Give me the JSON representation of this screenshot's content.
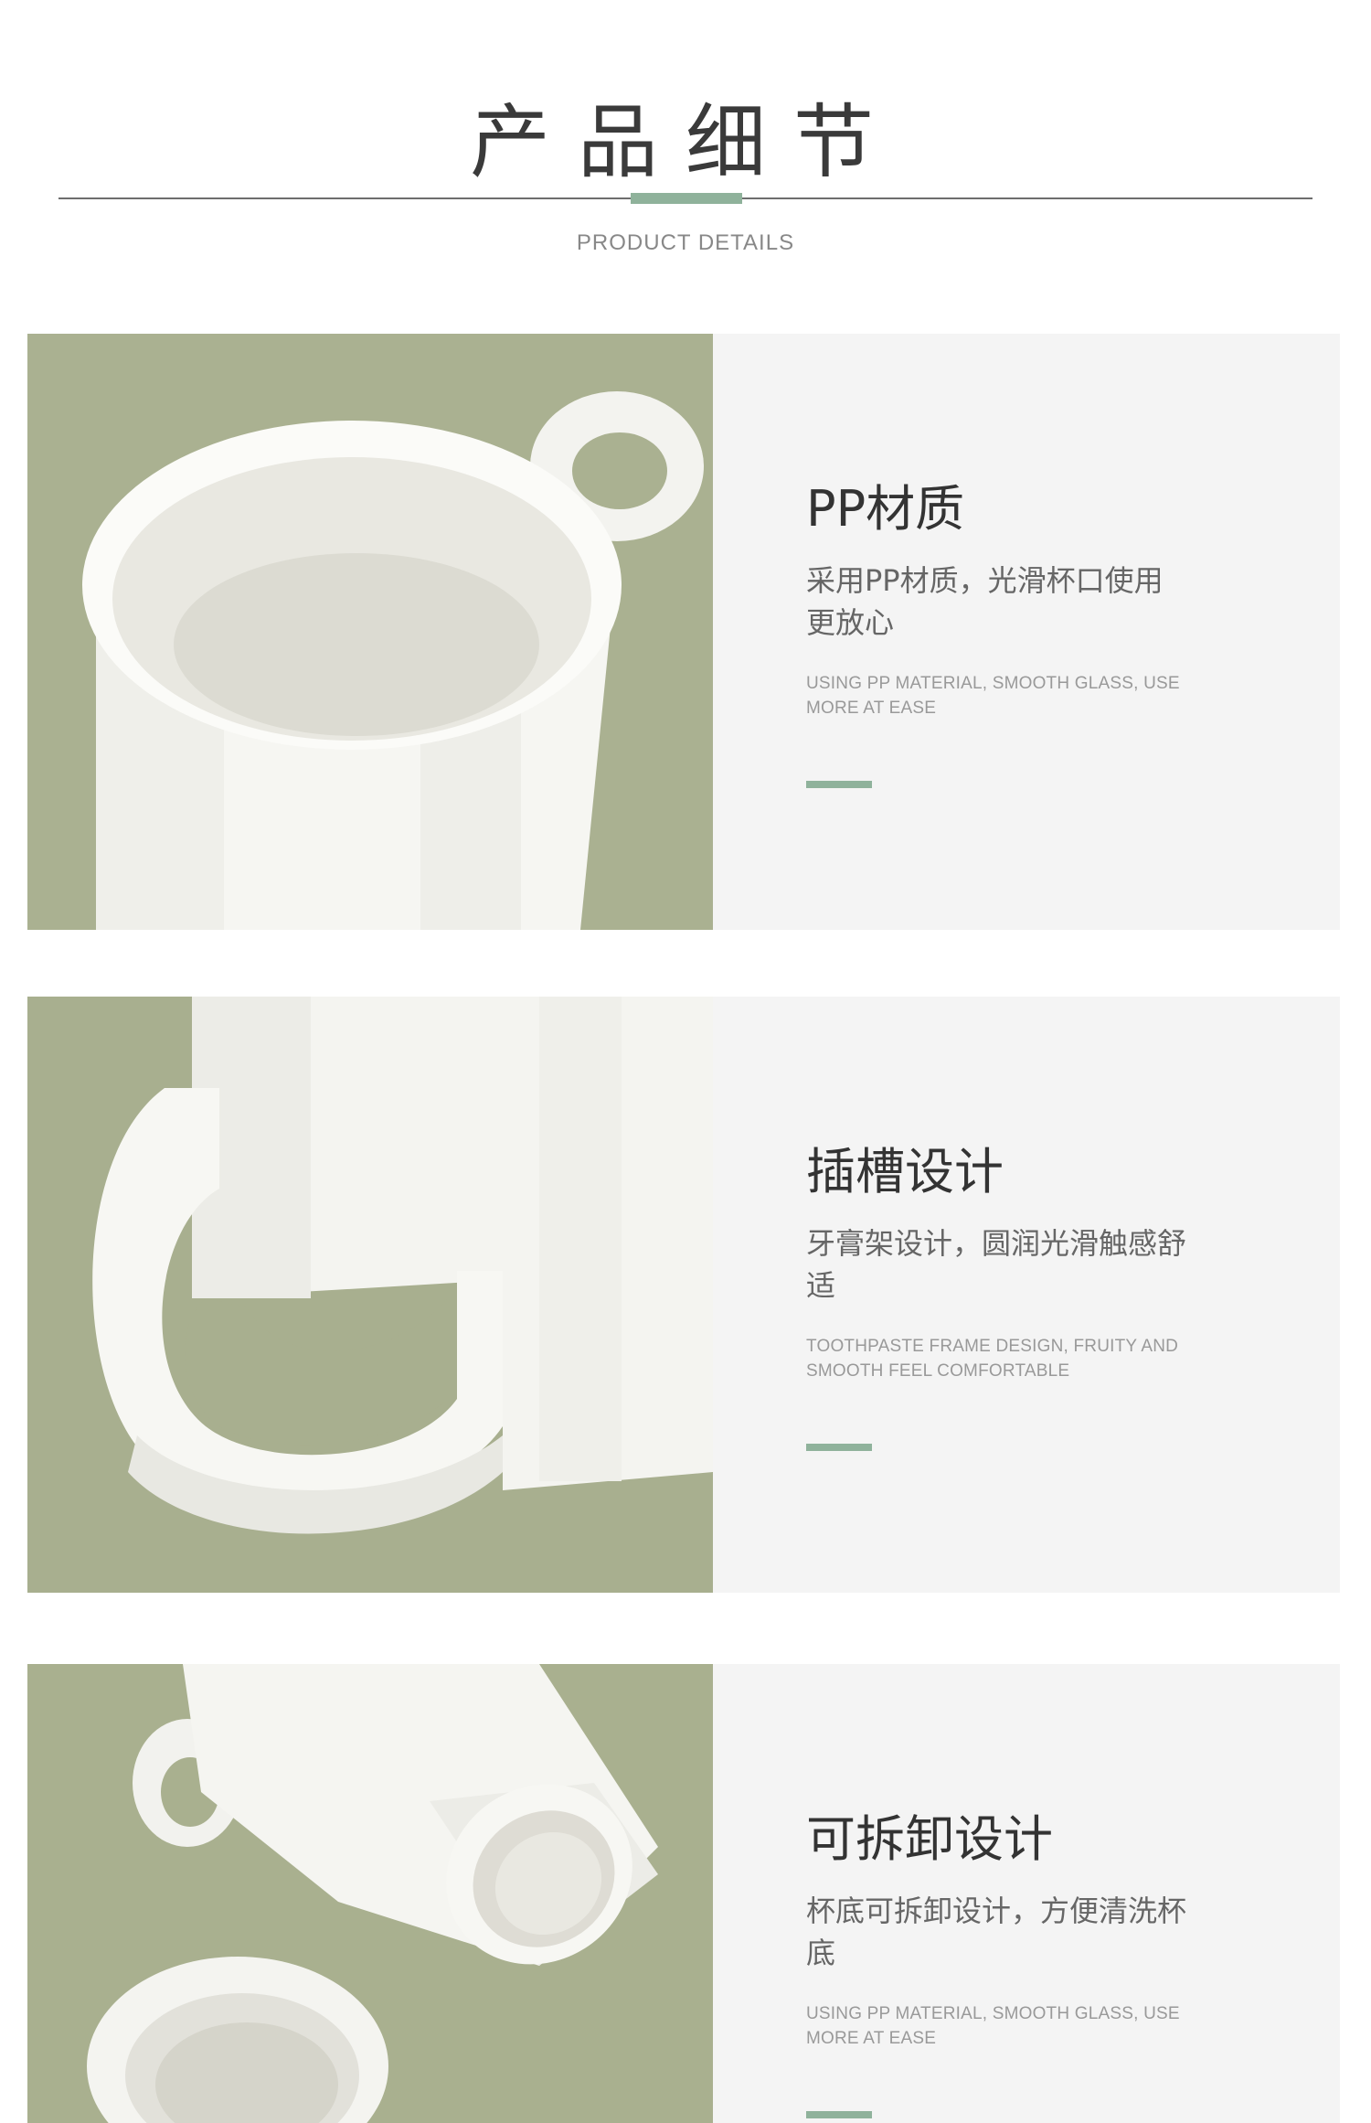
{
  "header": {
    "title": "产品细节",
    "subtitle": "PRODUCT DETAILS",
    "accent_color": "#8fb29b"
  },
  "features": [
    {
      "title": "PP材质",
      "desc": "采用PP材质，光滑杯口使用更放心",
      "desc_en": "USING PP MATERIAL, SMOOTH GLASS, USE MORE AT EASE",
      "photo": "cup-rim-photo"
    },
    {
      "title": "插槽设计",
      "desc": "牙膏架设计，圆润光滑触感舒适",
      "desc_en": "TOOTHPASTE FRAME DESIGN, FRUITY AND SMOOTH FEEL COMFORTABLE",
      "photo": "cup-handle-photo"
    },
    {
      "title": "可拆卸设计",
      "desc": "杯底可拆卸设计，方便清洗杯底",
      "desc_en": "USING PP MATERIAL, SMOOTH GLASS, USE MORE AT EASE",
      "photo": "cup-bottom-photo"
    }
  ],
  "colors": {
    "photo_background": "#a9b08f",
    "card_background": "#f4f4f4",
    "cup_white": "#f6f6f2"
  }
}
